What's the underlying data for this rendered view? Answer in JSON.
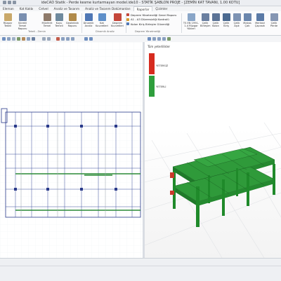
{
  "window": {
    "title": "ideCAD Statik - Perde kesme kurtarmayan model.ide10 - STATİK ŞABLON PROJE - [ZEMİN KAT TAVANI, 1.00 KOTU]"
  },
  "tabs": [
    {
      "label": "Eleman"
    },
    {
      "label": "Kat Kalıbı"
    },
    {
      "label": "Cetvel"
    },
    {
      "label": "Analiz ve Tasarım"
    },
    {
      "label": "Analiz ve Tasarım Dokümanları"
    },
    {
      "label": "Raporlar"
    },
    {
      "label": "Çizimler"
    }
  ],
  "ribbon": {
    "groups": {
      "tekeli_zemin": "Tekeli - Zemin",
      "dinamik_analiz": "Dinamik Analiz",
      "deprem": "Deprem Yönetmeliği"
    },
    "buttons": [
      {
        "label": "Rüzgar Tekeli"
      },
      {
        "label": "Sürekli Temel Raporu"
      },
      {
        "label": "Münferit Temel"
      },
      {
        "label": "Kuyu Temeli"
      },
      {
        "label": "Geoteknik Raporu"
      },
      {
        "label": "Dinamik Analiz"
      },
      {
        "label": "Kat Kuvvetleri"
      },
      {
        "label": "Deprem Kuvvetleri"
      },
      {
        "label": "TS EN 1991-1-4 Rüzgar Yükleri"
      },
      {
        "label": "Çelik Birleşim"
      },
      {
        "label": "Çelik Kolon"
      },
      {
        "label": "Çelik Kiriş"
      },
      {
        "label": "Çelik Aşık"
      },
      {
        "label": "Makas Çatı"
      },
      {
        "label": "Merkezi Çaprazlı"
      },
      {
        "label": "Çelik Perde"
      }
    ],
    "deprem_items": [
      {
        "label": "Deprem Yönetmeliği Genel Raporu"
      },
      {
        "label": "A1 - A3 Düzensizliği Kontrolü"
      },
      {
        "label": "Kolon Kiriş Birleşim Güvenliği"
      }
    ]
  },
  "panel3d": {
    "title": "Tüm yeterlilikler",
    "legend": [
      {
        "label": "YETERSİZ",
        "color": "#d62b1f"
      },
      {
        "label": "YETERLİ",
        "color": "#2e9e3c"
      }
    ]
  },
  "colors": {
    "accent": "#2a62b8",
    "plan_bg": "#ffffff",
    "beam_green": "#2a8a36",
    "frame_green": "#1f8a2a"
  }
}
